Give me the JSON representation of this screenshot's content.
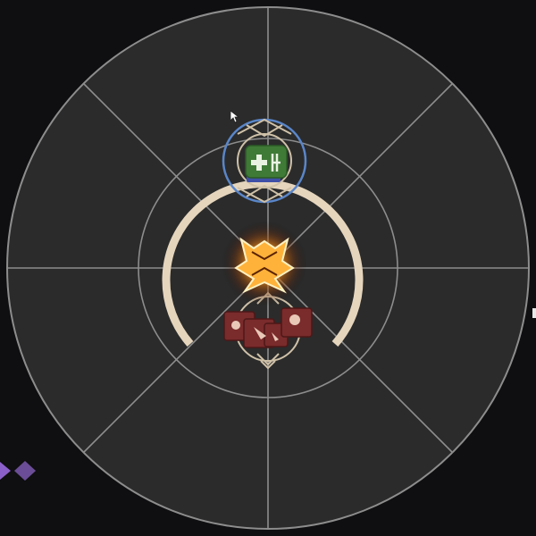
{
  "hud": {
    "arena": {
      "spokes": 8,
      "rings": 3,
      "floor_color": "#2b2b2b",
      "line_color": "#8d8d8d"
    },
    "boss_ring": {
      "color": "#e5d5bd"
    },
    "party_markers": {
      "colors": [
        "#8b5fc9",
        "#6a4d96"
      ]
    },
    "player_marker": {
      "role": "healer",
      "role_color": "#3f7a37",
      "ring_color": "#5a86c9"
    },
    "party_stack": {
      "role": "dps",
      "count": 3,
      "role_color": "#7a2b2b"
    },
    "boss_marker": {
      "glow_color": "#ff9a1a"
    }
  }
}
